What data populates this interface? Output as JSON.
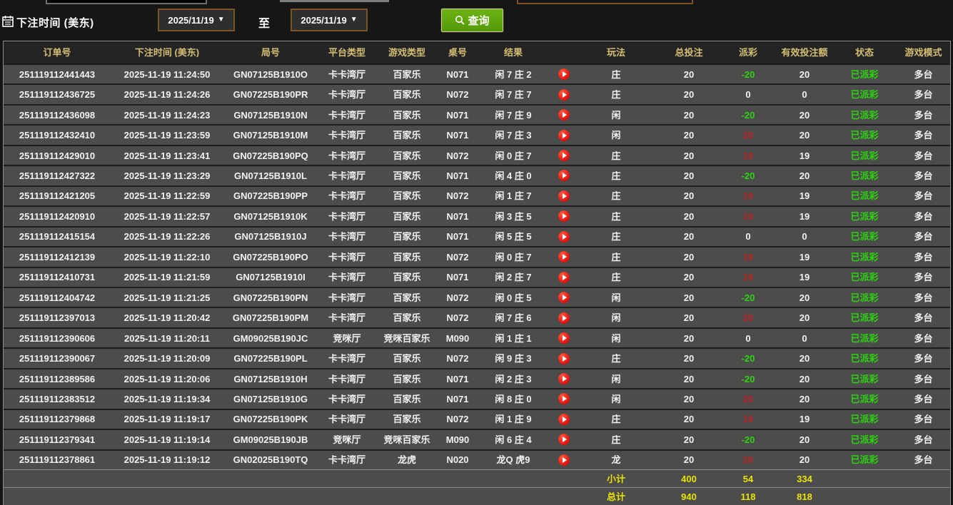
{
  "topbar": {
    "field_label": "下注时间 (美东)",
    "date_from": "2025/11/19",
    "to_label": "至",
    "date_to": "2025/11/19",
    "query_label": "查询"
  },
  "icons": {
    "calendar": "calendar-icon",
    "search": "search-icon",
    "replay": "play-icon",
    "dropdown_arrow": "▼"
  },
  "colors": {
    "button_green": "#5ea50c",
    "payout_negative_green": "#2bd40e",
    "payout_positive_red": "#b82525",
    "status_green": "#2bd40e",
    "summary_yellow": "#e8e400",
    "header_text": "#d2bd72",
    "date_border_brown": "#7d5226"
  },
  "table": {
    "headers": [
      "订单号",
      "下注时间 (美东)",
      "局号",
      "平台类型",
      "游戏类型",
      "桌号",
      "结果",
      "",
      "玩法",
      "总投注",
      "派彩",
      "有效投注额",
      "状态",
      "游戏模式"
    ],
    "rows": [
      {
        "order": "251119112441443",
        "time": "2025-11-19 11:24:50",
        "round": "GN07125B1910O",
        "platform": "卡卡湾厅",
        "game": "百家乐",
        "table": "N071",
        "result": "闲 7 庄 2",
        "play": "庄",
        "total": "20",
        "payout": "-20",
        "payout_sign": "neg",
        "valid": "20",
        "status": "已派彩",
        "mode": "多台"
      },
      {
        "order": "251119112436725",
        "time": "2025-11-19 11:24:26",
        "round": "GN07225B190PR",
        "platform": "卡卡湾厅",
        "game": "百家乐",
        "table": "N072",
        "result": "闲 7 庄 7",
        "play": "庄",
        "total": "20",
        "payout": "0",
        "payout_sign": "zero",
        "valid": "0",
        "status": "已派彩",
        "mode": "多台"
      },
      {
        "order": "251119112436098",
        "time": "2025-11-19 11:24:23",
        "round": "GN07125B1910N",
        "platform": "卡卡湾厅",
        "game": "百家乐",
        "table": "N071",
        "result": "闲 7 庄 9",
        "play": "闲",
        "total": "20",
        "payout": "-20",
        "payout_sign": "neg",
        "valid": "20",
        "status": "已派彩",
        "mode": "多台"
      },
      {
        "order": "251119112432410",
        "time": "2025-11-19 11:23:59",
        "round": "GN07125B1910M",
        "platform": "卡卡湾厅",
        "game": "百家乐",
        "table": "N071",
        "result": "闲 7 庄 3",
        "play": "闲",
        "total": "20",
        "payout": "20",
        "payout_sign": "pos",
        "valid": "20",
        "status": "已派彩",
        "mode": "多台"
      },
      {
        "order": "251119112429010",
        "time": "2025-11-19 11:23:41",
        "round": "GN07225B190PQ",
        "platform": "卡卡湾厅",
        "game": "百家乐",
        "table": "N072",
        "result": "闲 0 庄 7",
        "play": "庄",
        "total": "20",
        "payout": "19",
        "payout_sign": "pos",
        "valid": "19",
        "status": "已派彩",
        "mode": "多台"
      },
      {
        "order": "251119112427322",
        "time": "2025-11-19 11:23:29",
        "round": "GN07125B1910L",
        "platform": "卡卡湾厅",
        "game": "百家乐",
        "table": "N071",
        "result": "闲 4 庄 0",
        "play": "庄",
        "total": "20",
        "payout": "-20",
        "payout_sign": "neg",
        "valid": "20",
        "status": "已派彩",
        "mode": "多台"
      },
      {
        "order": "251119112421205",
        "time": "2025-11-19 11:22:59",
        "round": "GN07225B190PP",
        "platform": "卡卡湾厅",
        "game": "百家乐",
        "table": "N072",
        "result": "闲 1 庄 7",
        "play": "庄",
        "total": "20",
        "payout": "19",
        "payout_sign": "pos",
        "valid": "19",
        "status": "已派彩",
        "mode": "多台"
      },
      {
        "order": "251119112420910",
        "time": "2025-11-19 11:22:57",
        "round": "GN07125B1910K",
        "platform": "卡卡湾厅",
        "game": "百家乐",
        "table": "N071",
        "result": "闲 3 庄 5",
        "play": "庄",
        "total": "20",
        "payout": "19",
        "payout_sign": "pos",
        "valid": "19",
        "status": "已派彩",
        "mode": "多台"
      },
      {
        "order": "251119112415154",
        "time": "2025-11-19 11:22:26",
        "round": "GN07125B1910J",
        "platform": "卡卡湾厅",
        "game": "百家乐",
        "table": "N071",
        "result": "闲 5 庄 5",
        "play": "庄",
        "total": "20",
        "payout": "0",
        "payout_sign": "zero",
        "valid": "0",
        "status": "已派彩",
        "mode": "多台"
      },
      {
        "order": "251119112412139",
        "time": "2025-11-19 11:22:10",
        "round": "GN07225B190PO",
        "platform": "卡卡湾厅",
        "game": "百家乐",
        "table": "N072",
        "result": "闲 0 庄 7",
        "play": "庄",
        "total": "20",
        "payout": "19",
        "payout_sign": "pos",
        "valid": "19",
        "status": "已派彩",
        "mode": "多台"
      },
      {
        "order": "251119112410731",
        "time": "2025-11-19 11:21:59",
        "round": "GN07125B1910I",
        "platform": "卡卡湾厅",
        "game": "百家乐",
        "table": "N071",
        "result": "闲 2 庄 7",
        "play": "庄",
        "total": "20",
        "payout": "19",
        "payout_sign": "pos",
        "valid": "19",
        "status": "已派彩",
        "mode": "多台"
      },
      {
        "order": "251119112404742",
        "time": "2025-11-19 11:21:25",
        "round": "GN07225B190PN",
        "platform": "卡卡湾厅",
        "game": "百家乐",
        "table": "N072",
        "result": "闲 0 庄 5",
        "play": "闲",
        "total": "20",
        "payout": "-20",
        "payout_sign": "neg",
        "valid": "20",
        "status": "已派彩",
        "mode": "多台"
      },
      {
        "order": "251119112397013",
        "time": "2025-11-19 11:20:42",
        "round": "GN07225B190PM",
        "platform": "卡卡湾厅",
        "game": "百家乐",
        "table": "N072",
        "result": "闲 7 庄 6",
        "play": "闲",
        "total": "20",
        "payout": "20",
        "payout_sign": "pos",
        "valid": "20",
        "status": "已派彩",
        "mode": "多台"
      },
      {
        "order": "251119112390606",
        "time": "2025-11-19 11:20:11",
        "round": "GM09025B190JC",
        "platform": "竞咪厅",
        "game": "竞咪百家乐",
        "table": "M090",
        "result": "闲 1 庄 1",
        "play": "闲",
        "total": "20",
        "payout": "0",
        "payout_sign": "zero",
        "valid": "0",
        "status": "已派彩",
        "mode": "多台"
      },
      {
        "order": "251119112390067",
        "time": "2025-11-19 11:20:09",
        "round": "GN07225B190PL",
        "platform": "卡卡湾厅",
        "game": "百家乐",
        "table": "N072",
        "result": "闲 9 庄 3",
        "play": "庄",
        "total": "20",
        "payout": "-20",
        "payout_sign": "neg",
        "valid": "20",
        "status": "已派彩",
        "mode": "多台"
      },
      {
        "order": "251119112389586",
        "time": "2025-11-19 11:20:06",
        "round": "GN07125B1910H",
        "platform": "卡卡湾厅",
        "game": "百家乐",
        "table": "N071",
        "result": "闲 2 庄 3",
        "play": "闲",
        "total": "20",
        "payout": "-20",
        "payout_sign": "neg",
        "valid": "20",
        "status": "已派彩",
        "mode": "多台"
      },
      {
        "order": "251119112383512",
        "time": "2025-11-19 11:19:34",
        "round": "GN07125B1910G",
        "platform": "卡卡湾厅",
        "game": "百家乐",
        "table": "N071",
        "result": "闲 8 庄 0",
        "play": "闲",
        "total": "20",
        "payout": "20",
        "payout_sign": "pos",
        "valid": "20",
        "status": "已派彩",
        "mode": "多台"
      },
      {
        "order": "251119112379868",
        "time": "2025-11-19 11:19:17",
        "round": "GN07225B190PK",
        "platform": "卡卡湾厅",
        "game": "百家乐",
        "table": "N072",
        "result": "闲 1 庄 9",
        "play": "庄",
        "total": "20",
        "payout": "19",
        "payout_sign": "pos",
        "valid": "19",
        "status": "已派彩",
        "mode": "多台"
      },
      {
        "order": "251119112379341",
        "time": "2025-11-19 11:19:14",
        "round": "GM09025B190JB",
        "platform": "竞咪厅",
        "game": "竞咪百家乐",
        "table": "M090",
        "result": "闲 6 庄 4",
        "play": "庄",
        "total": "20",
        "payout": "-20",
        "payout_sign": "neg",
        "valid": "20",
        "status": "已派彩",
        "mode": "多台"
      },
      {
        "order": "251119112378861",
        "time": "2025-11-19 11:19:12",
        "round": "GN02025B190TQ",
        "platform": "卡卡湾厅",
        "game": "龙虎",
        "table": "N020",
        "result": "龙Q 虎9",
        "play": "龙",
        "total": "20",
        "payout": "20",
        "payout_sign": "pos",
        "valid": "20",
        "status": "已派彩",
        "mode": "多台"
      }
    ],
    "subtotal": {
      "label": "小计",
      "total_bet": "400",
      "payout": "54",
      "valid_bet": "334"
    },
    "total": {
      "label": "总计",
      "total_bet": "940",
      "payout": "118",
      "valid_bet": "818"
    }
  }
}
